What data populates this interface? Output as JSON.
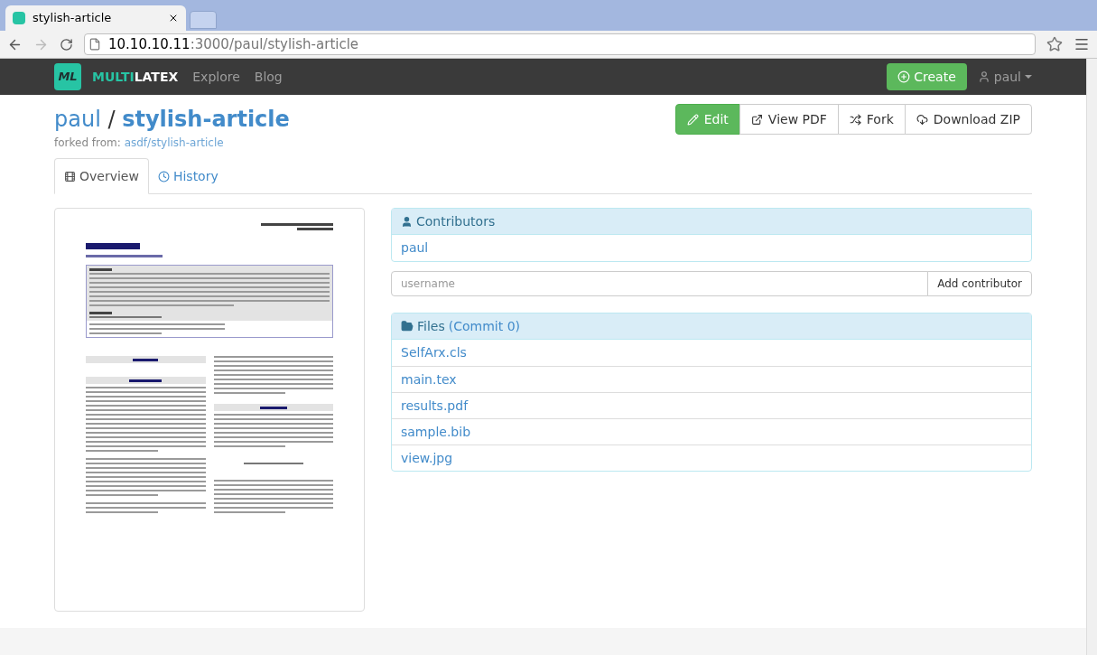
{
  "browser": {
    "tab_title": "stylish-article",
    "url_host": "10.10.10.11",
    "url_rest": ":3000/paul/stylish-article"
  },
  "navbar": {
    "brand_a": "MULTI",
    "brand_b": "LATEX",
    "logo": "ML",
    "links": [
      "Explore",
      "Blog"
    ],
    "create": "Create",
    "user": "paul"
  },
  "header": {
    "owner": "paul",
    "separator": "/",
    "repo": "stylish-article",
    "forked_label": "forked from:",
    "forked_link": "asdf/stylish-article"
  },
  "actions": [
    {
      "label": "Edit",
      "kind": "edit",
      "primary": true
    },
    {
      "label": "View PDF",
      "kind": "view",
      "primary": false
    },
    {
      "label": "Fork",
      "kind": "fork",
      "primary": false
    },
    {
      "label": "Download ZIP",
      "kind": "download",
      "primary": false
    }
  ],
  "tabs": [
    {
      "label": "Overview",
      "kind": "overview",
      "selected": true
    },
    {
      "label": "History",
      "kind": "history",
      "selected": false
    }
  ],
  "contributors": {
    "title": "Contributors",
    "items": [
      "paul"
    ],
    "placeholder": "username",
    "add": "Add contributor"
  },
  "files": {
    "title": "Files",
    "commit": "(Commit 0)",
    "items": [
      "SelfArx.cls",
      "main.tex",
      "results.pdf",
      "sample.bib",
      "view.jpg"
    ]
  }
}
